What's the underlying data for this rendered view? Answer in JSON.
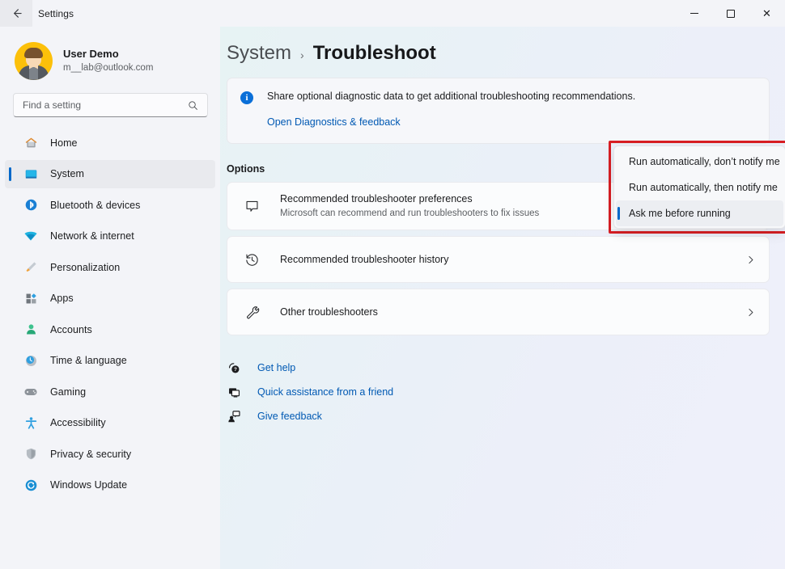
{
  "titlebar": {
    "back_label": "back-arrow",
    "title": "Settings",
    "minimize": "minimize",
    "maximize": "maximize",
    "close": "✕"
  },
  "sidebar": {
    "profile": {
      "name": "User Demo",
      "email": "m__lab@outlook.com"
    },
    "search": {
      "placeholder": "Find a setting",
      "value": ""
    },
    "items": [
      {
        "label": "Home",
        "icon": "home-icon",
        "selected": false
      },
      {
        "label": "System",
        "icon": "system-icon",
        "selected": true
      },
      {
        "label": "Bluetooth & devices",
        "icon": "bluetooth-icon",
        "selected": false
      },
      {
        "label": "Network & internet",
        "icon": "wifi-icon",
        "selected": false
      },
      {
        "label": "Personalization",
        "icon": "paintbrush-icon",
        "selected": false
      },
      {
        "label": "Apps",
        "icon": "apps-icon",
        "selected": false
      },
      {
        "label": "Accounts",
        "icon": "account-icon",
        "selected": false
      },
      {
        "label": "Time & language",
        "icon": "clock-globe-icon",
        "selected": false
      },
      {
        "label": "Gaming",
        "icon": "gamepad-icon",
        "selected": false
      },
      {
        "label": "Accessibility",
        "icon": "accessibility-icon",
        "selected": false
      },
      {
        "label": "Privacy & security",
        "icon": "shield-icon",
        "selected": false
      },
      {
        "label": "Windows Update",
        "icon": "update-icon",
        "selected": false
      }
    ]
  },
  "main": {
    "breadcrumb": {
      "parent": "System",
      "separator": "›",
      "current": "Troubleshoot"
    },
    "banner": {
      "icon": "info-icon",
      "text": "Share optional diagnostic data to get additional troubleshooting recommendations.",
      "link": "Open Diagnostics & feedback"
    },
    "section_title": "Options",
    "cards": [
      {
        "icon": "speech-bubble-icon",
        "title": "Recommended troubleshooter preferences",
        "subtitle": "Microsoft can recommend and run troubleshooters to fix issues",
        "chevron": ""
      },
      {
        "icon": "history-clock-icon",
        "title": "Recommended troubleshooter history",
        "subtitle": "",
        "chevron": "›"
      },
      {
        "icon": "wrench-icon",
        "title": "Other troubleshooters",
        "subtitle": "",
        "chevron": "›"
      }
    ],
    "links": [
      {
        "icon": "help-question-icon",
        "label": "Get help"
      },
      {
        "icon": "monitor-share-icon",
        "label": "Quick assistance from a friend"
      },
      {
        "icon": "feedback-person-icon",
        "label": "Give feedback"
      }
    ]
  },
  "dropdown": {
    "options": [
      {
        "label": "Run automatically, don’t notify me",
        "selected": false
      },
      {
        "label": "Run automatically, then notify me",
        "selected": false
      },
      {
        "label": "Ask me before running",
        "selected": true
      }
    ],
    "highlight_color": "#d81e23",
    "accent_color": "#0068c9"
  }
}
